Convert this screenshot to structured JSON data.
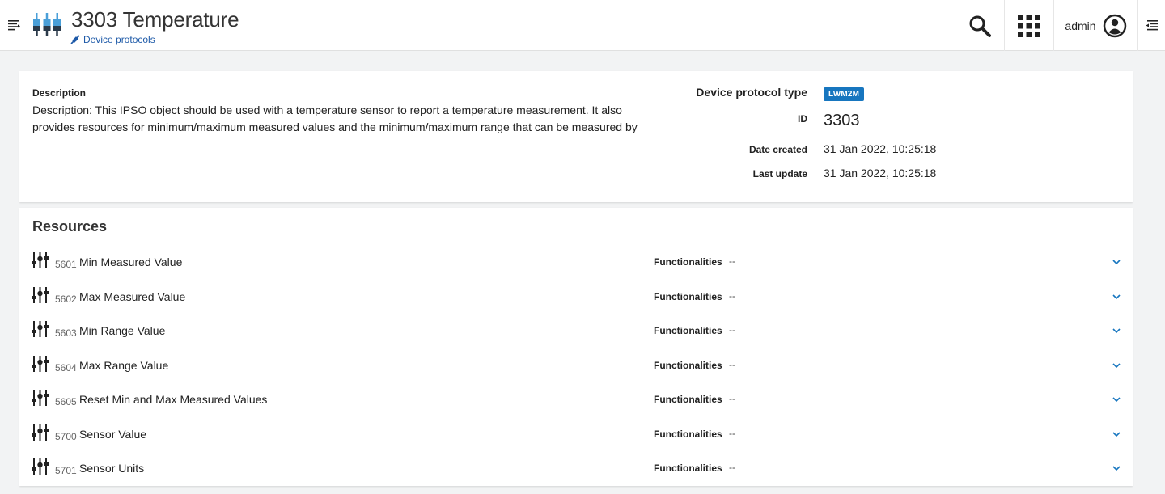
{
  "header": {
    "title": "3303 Temperature",
    "breadcrumb": "Device protocols",
    "user": "admin",
    "icons": {
      "menu": "menu-lines-icon",
      "logo": "device-protocol-icon",
      "crumb": "protocol-small-icon",
      "search": "search-icon",
      "apps": "app-grid-icon",
      "user": "user-circle-icon",
      "right": "right-drawer-icon"
    }
  },
  "info": {
    "description_label": "Description",
    "description_text": "Description: This IPSO object should be used with a temperature sensor to report a temperature measurement.  It also provides resources for minimum/maximum measured values and the minimum/maximum range that can be measured by",
    "protocol_type_label": "Device protocol type",
    "protocol_type_value": "LWM2M",
    "id_label": "ID",
    "id_value": "3303",
    "date_created_label": "Date created",
    "date_created_value": "31 Jan 2022, 10:25:18",
    "last_update_label": "Last update",
    "last_update_value": "31 Jan 2022, 10:25:18"
  },
  "resources": {
    "title": "Resources",
    "items": [
      {
        "id": "5601",
        "name": "Min Measured Value",
        "func_label": "Functionalities",
        "func_value": "--"
      },
      {
        "id": "5602",
        "name": "Max Measured Value",
        "func_label": "Functionalities",
        "func_value": "--"
      },
      {
        "id": "5603",
        "name": "Min Range Value",
        "func_label": "Functionalities",
        "func_value": "--"
      },
      {
        "id": "5604",
        "name": "Max Range Value",
        "func_label": "Functionalities",
        "func_value": "--"
      },
      {
        "id": "5605",
        "name": "Reset Min and Max Measured Values",
        "func_label": "Functionalities",
        "func_value": "--"
      },
      {
        "id": "5700",
        "name": "Sensor Value",
        "func_label": "Functionalities",
        "func_value": "--"
      },
      {
        "id": "5701",
        "name": "Sensor Units",
        "func_label": "Functionalities",
        "func_value": "--"
      }
    ]
  },
  "colors": {
    "accent": "#1776bf",
    "link": "#1e5aa8",
    "logo": "#4a9fd8"
  }
}
